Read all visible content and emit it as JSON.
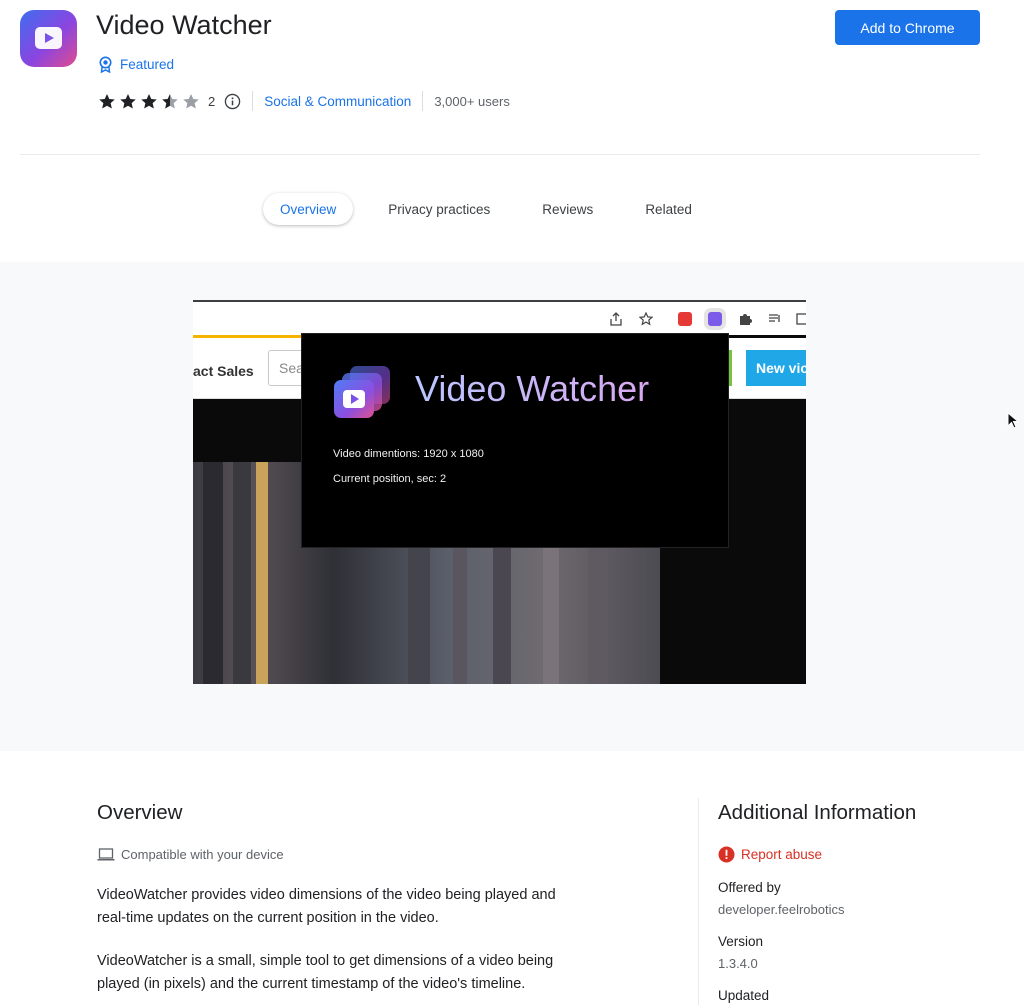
{
  "header": {
    "title": "Video Watcher",
    "featured_label": "Featured",
    "rating": 3.5,
    "rating_count": "2",
    "category": "Social & Communication",
    "users": "3,000+ users",
    "add_button": "Add to Chrome",
    "accent": "#1a73e8"
  },
  "tabs": [
    {
      "label": "Overview",
      "active": true
    },
    {
      "label": "Privacy practices",
      "active": false
    },
    {
      "label": "Reviews",
      "active": false
    },
    {
      "label": "Related",
      "active": false
    }
  ],
  "screenshot": {
    "page_text_sales": "act Sales",
    "search_placeholder": "Sea",
    "new_video_button": "New vic",
    "popup_title": "Video Watcher",
    "popup_dimensions": "Video dimentions: 1920 x 1080",
    "popup_position": "Current position, sec: 2"
  },
  "overview": {
    "title": "Overview",
    "compatible": "Compatible with your device",
    "para1_line1": "VideoWatcher provides video dimensions of the video being played and",
    "para1_line2": "real-time updates on the current position in the video.",
    "para2_line1": "VideoWatcher is a small, simple tool to get dimensions of a video being",
    "para2_line2": "played (in pixels) and the current timestamp of the video's timeline."
  },
  "additional_info": {
    "title": "Additional Information",
    "report_abuse": "Report abuse",
    "offered_by_label": "Offered by",
    "offered_by_value": "developer.feelrobotics",
    "version_label": "Version",
    "version_value": "1.3.4.0",
    "updated_label": "Updated"
  }
}
